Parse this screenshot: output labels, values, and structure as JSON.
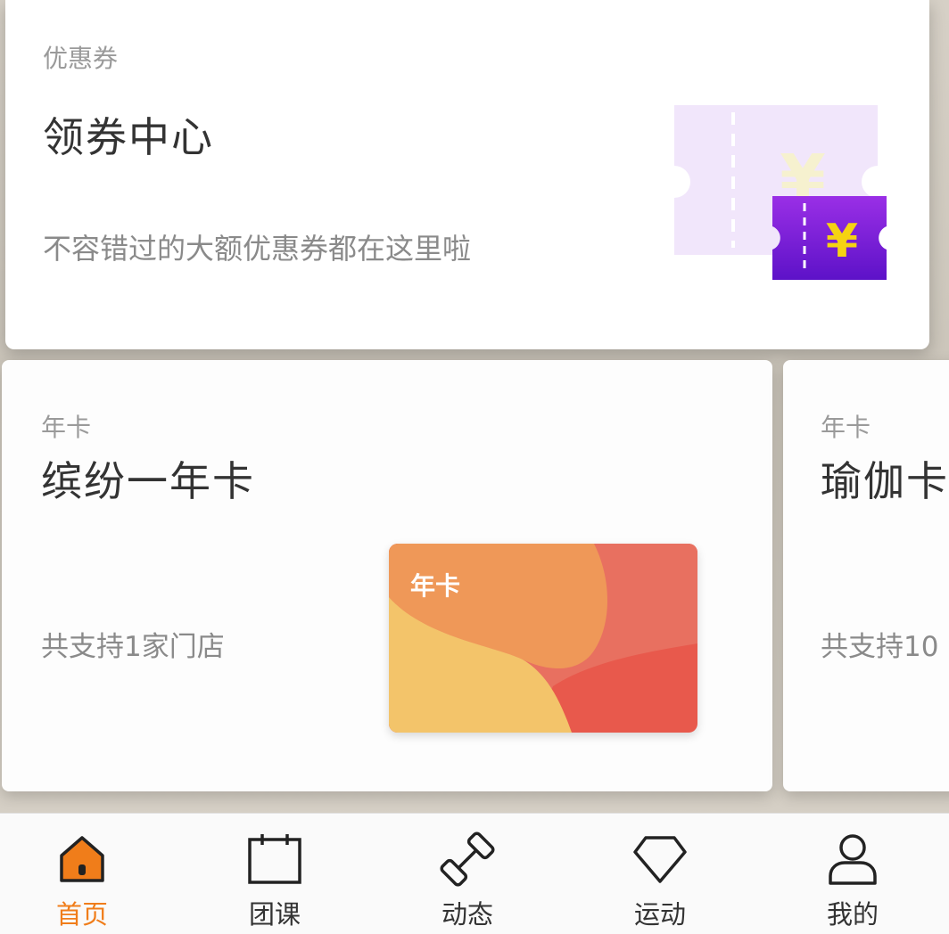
{
  "coupon_card": {
    "category": "优惠券",
    "title": "领券中心",
    "description": "不容错过的大额优惠券都在这里啦",
    "icon": "coupon-ticket-icon",
    "currency_symbol": "¥",
    "colors": {
      "ticket": "#7a1fd6",
      "ticket_faded": "#efe2fa",
      "symbol": "#f5d312"
    }
  },
  "membership_cards": [
    {
      "category": "年卡",
      "name": "缤纷一年卡",
      "stores": "共支持1家门店",
      "card_label": "年卡",
      "colors": [
        "#f3c46a",
        "#ef9858",
        "#e87060",
        "#e8594c"
      ]
    },
    {
      "category": "年卡",
      "name": "瑜伽卡",
      "stores": "共支持10"
    }
  ],
  "tabbar": {
    "accent": "#f07d1a",
    "items": [
      {
        "label": "首页",
        "icon": "home-icon",
        "active": true
      },
      {
        "label": "团课",
        "icon": "calendar-icon",
        "active": false
      },
      {
        "label": "动态",
        "icon": "dumbbell-icon",
        "active": false
      },
      {
        "label": "运动",
        "icon": "diamond-icon",
        "active": false
      },
      {
        "label": "我的",
        "icon": "user-icon",
        "active": false
      }
    ]
  }
}
